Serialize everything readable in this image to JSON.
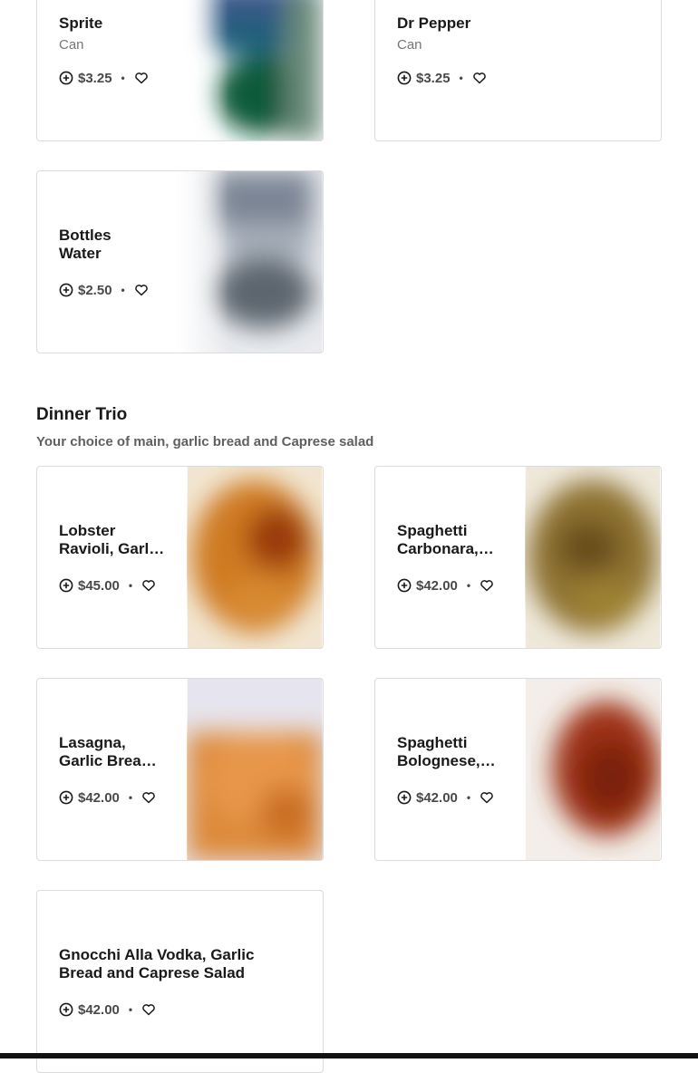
{
  "drinks": {
    "items": [
      {
        "name": "Sprite",
        "sub": "Can",
        "price": "$3.25"
      },
      {
        "name": "Dr Pepper",
        "sub": "Can",
        "price": "$3.25"
      },
      {
        "name": "Bottles Water",
        "price": "$2.50"
      }
    ]
  },
  "dinner_trio": {
    "title": "Dinner Trio",
    "subtitle": "Your choice of main, garlic bread and Caprese salad",
    "items": [
      {
        "name": "Lobster Ravioli, Garlic Bread and Caprese Salad",
        "price": "$45.00"
      },
      {
        "name": "Spaghetti Carbonara, Garlic Bread and Caprese Salad",
        "price": "$42.00"
      },
      {
        "name": "Lasagna, Garlic Bread and Caprese Salad",
        "price": "$42.00"
      },
      {
        "name": "Spaghetti Bolognese, Garlic Bread and Caprese Salad",
        "price": "$42.00"
      },
      {
        "name": "Gnocchi Alla Vodka, Garlic Bread and Caprese Salad",
        "price": "$42.00"
      }
    ]
  },
  "separator": "•",
  "icons": {
    "add": "add-circle-icon",
    "favorite": "heart-outline-icon"
  }
}
